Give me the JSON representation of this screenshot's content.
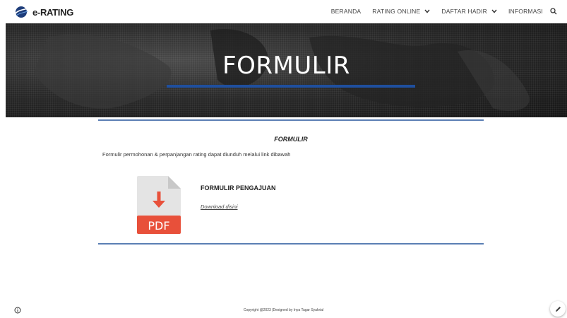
{
  "header": {
    "brand": "e-RATING",
    "nav": [
      {
        "label": "BERANDA",
        "dropdown": false
      },
      {
        "label": "RATING ONLINE",
        "dropdown": true
      },
      {
        "label": "DAFTAR HADIR",
        "dropdown": true
      },
      {
        "label": "INFORMASI",
        "dropdown": false
      }
    ]
  },
  "hero": {
    "title": "FORMULIR"
  },
  "content": {
    "section_title": "FORMULIR",
    "intro": "Formulir permohonan & perpanjangan rating dapat diunduh melalui link dibawah",
    "item": {
      "icon_label": "PDF",
      "title": "FORMULIR PENGAJUAN",
      "link": "Download disini"
    }
  },
  "footer": {
    "copyright": "Copyright @2023 |Designed by Inya Tagar Syakrial"
  },
  "colors": {
    "accent_blue": "#1f4f9e",
    "rule_blue": "#5b7fb4",
    "pdf_red": "#e8503a"
  },
  "icons": {
    "logo": "globe-swoosh-logo",
    "search": "search-icon",
    "info": "info-icon",
    "edit": "pencil-icon"
  }
}
